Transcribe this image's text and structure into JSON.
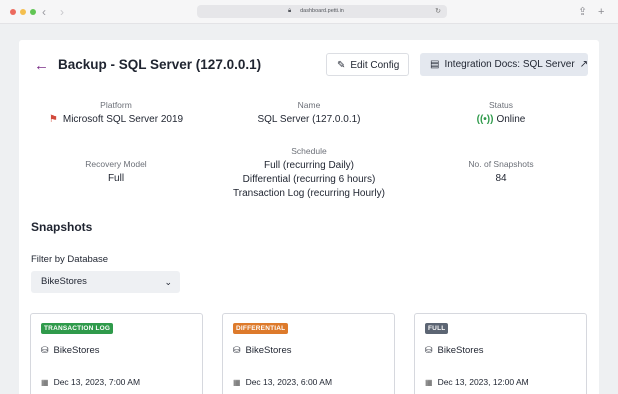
{
  "browser": {
    "url": "dashboard.petti.in",
    "traffic_colors": [
      "#ec6a5e",
      "#f4bf4f",
      "#61c554"
    ]
  },
  "header": {
    "title": "Backup - SQL Server (127.0.0.1)",
    "edit_label": "Edit Config",
    "docs_label": "Integration Docs: SQL Server"
  },
  "info": {
    "platform_label": "Platform",
    "platform_value": "Microsoft SQL Server 2019",
    "name_label": "Name",
    "name_value": "SQL Server (127.0.0.1)",
    "status_label": "Status",
    "status_value": "Online",
    "recovery_label": "Recovery Model",
    "recovery_value": "Full",
    "schedule_label": "Schedule",
    "schedule_lines": [
      "Full (recurring Daily)",
      "Differential (recurring 6 hours)",
      "Transaction Log (recurring Hourly)"
    ],
    "snapshots_label": "No. of Snapshots",
    "snapshots_value": "84"
  },
  "snapshots": {
    "title": "Snapshots",
    "filter_label": "Filter by Database",
    "filter_value": "BikeStores",
    "cards": [
      {
        "badge": "TRANSACTION LOG",
        "badge_color": "#2f9a4b",
        "database": "BikeStores",
        "date": "Dec 13, 2023, 7:00 AM"
      },
      {
        "badge": "DIFFERENTIAL",
        "badge_color": "#dd7a2b",
        "database": "BikeStores",
        "date": "Dec 13, 2023, 6:00 AM"
      },
      {
        "badge": "FULL",
        "badge_color": "#5c6573",
        "database": "BikeStores",
        "date": "Dec 13, 2023, 12:00 AM"
      }
    ]
  },
  "colors": {
    "accent": "#7a2c86",
    "online": "#2f9a4b"
  }
}
